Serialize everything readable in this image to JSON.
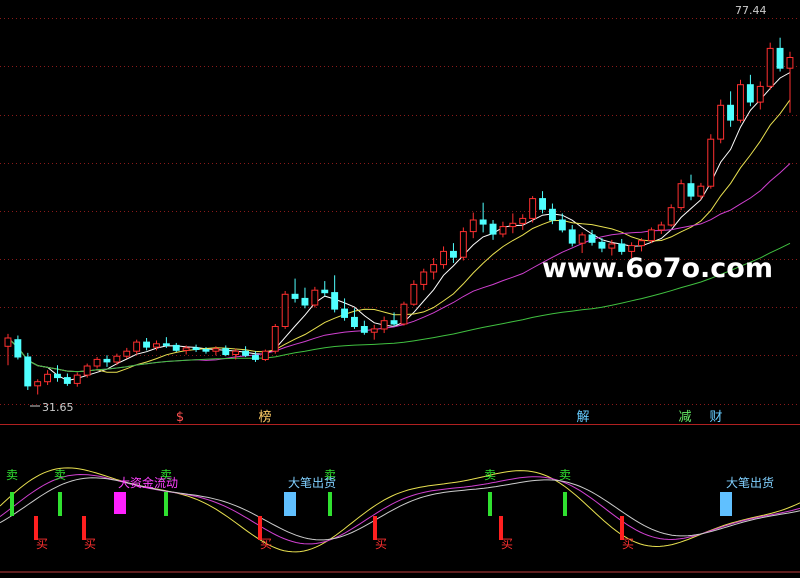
{
  "chart_data": {
    "type": "candlestick",
    "y_top_label": "77.44",
    "y_low_label": "31.65",
    "watermark": "www.6o7o.com",
    "markers": [
      {
        "text": "$",
        "color": "#ff5050"
      },
      {
        "text": "榜",
        "color": "#ffcc66"
      },
      {
        "text": "解",
        "color": "#66ccff"
      },
      {
        "text": "减",
        "color": "#66ee66"
      },
      {
        "text": "财",
        "color": "#66ccff"
      }
    ],
    "lower_labels": {
      "sell": "卖",
      "buy": "买",
      "inflow": "大资金流动",
      "outflow": "大笔出货"
    },
    "candles": [
      [
        37.5,
        39,
        35.2,
        38.5
      ],
      [
        38.3,
        38.8,
        35.9,
        36.2
      ],
      [
        36.2,
        36.7,
        32.2,
        32.7
      ],
      [
        32.7,
        33.5,
        31.65,
        33.2
      ],
      [
        33.2,
        34.6,
        32.8,
        34.1
      ],
      [
        34.1,
        35.2,
        33.2,
        33.7
      ],
      [
        33.7,
        34.2,
        32.7,
        33.0
      ],
      [
        33.0,
        34.3,
        32.6,
        34.0
      ],
      [
        34.0,
        35.4,
        33.7,
        35.1
      ],
      [
        35.1,
        36.2,
        34.8,
        35.9
      ],
      [
        35.9,
        36.4,
        35.0,
        35.6
      ],
      [
        35.6,
        36.6,
        35.2,
        36.3
      ],
      [
        36.3,
        37.3,
        36.0,
        36.9
      ],
      [
        36.9,
        38.3,
        36.5,
        38.0
      ],
      [
        38.0,
        38.5,
        37.0,
        37.4
      ],
      [
        37.4,
        38.2,
        37.0,
        37.8
      ],
      [
        37.8,
        38.6,
        37.3,
        37.6
      ],
      [
        37.6,
        37.9,
        36.8,
        37.0
      ],
      [
        37.0,
        37.6,
        36.5,
        37.3
      ],
      [
        37.3,
        37.7,
        36.8,
        37.1
      ],
      [
        37.1,
        37.4,
        36.6,
        36.9
      ],
      [
        36.9,
        37.5,
        36.4,
        37.2
      ],
      [
        37.2,
        37.6,
        36.3,
        36.5
      ],
      [
        36.5,
        37.2,
        35.9,
        36.9
      ],
      [
        36.9,
        37.5,
        36.2,
        36.4
      ],
      [
        36.4,
        36.9,
        35.6,
        35.9
      ],
      [
        35.9,
        37.1,
        35.7,
        36.9
      ],
      [
        36.9,
        40.2,
        36.6,
        39.9
      ],
      [
        39.9,
        44.2,
        39.6,
        43.8
      ],
      [
        43.8,
        45.7,
        42.8,
        43.3
      ],
      [
        43.3,
        44.6,
        42.1,
        42.5
      ],
      [
        42.5,
        44.7,
        42.2,
        44.3
      ],
      [
        44.3,
        45.4,
        43.6,
        44.0
      ],
      [
        44.0,
        46.1,
        41.6,
        42.0
      ],
      [
        42.0,
        43.3,
        40.6,
        41.0
      ],
      [
        41.0,
        42.1,
        39.6,
        39.9
      ],
      [
        39.9,
        40.6,
        38.9,
        39.2
      ],
      [
        39.2,
        40.1,
        38.3,
        39.6
      ],
      [
        39.6,
        41.1,
        39.1,
        40.6
      ],
      [
        40.6,
        41.6,
        39.9,
        40.2
      ],
      [
        40.2,
        42.9,
        40.0,
        42.6
      ],
      [
        42.6,
        45.5,
        42.4,
        45.0
      ],
      [
        45.0,
        46.9,
        44.3,
        46.5
      ],
      [
        46.5,
        48.2,
        45.6,
        47.4
      ],
      [
        47.4,
        49.6,
        46.9,
        49.0
      ],
      [
        49.0,
        50.0,
        47.6,
        48.3
      ],
      [
        48.3,
        51.9,
        47.9,
        51.4
      ],
      [
        51.4,
        53.7,
        50.6,
        52.8
      ],
      [
        52.8,
        54.9,
        51.3,
        52.3
      ],
      [
        52.3,
        52.8,
        50.4,
        51.1
      ],
      [
        51.1,
        52.6,
        50.7,
        52.0
      ],
      [
        52.0,
        53.6,
        51.2,
        52.4
      ],
      [
        52.4,
        53.5,
        51.6,
        53.0
      ],
      [
        53.0,
        55.7,
        52.5,
        55.4
      ],
      [
        55.4,
        56.3,
        53.6,
        54.1
      ],
      [
        54.1,
        54.8,
        52.3,
        52.8
      ],
      [
        52.8,
        53.6,
        51.3,
        51.6
      ],
      [
        51.6,
        52.2,
        49.6,
        50.0
      ],
      [
        50.0,
        51.3,
        48.8,
        51.0
      ],
      [
        51.0,
        51.6,
        49.7,
        50.1
      ],
      [
        50.1,
        50.6,
        48.9,
        49.4
      ],
      [
        49.4,
        50.4,
        48.5,
        49.9
      ],
      [
        49.9,
        50.5,
        48.6,
        49.0
      ],
      [
        49.0,
        50.1,
        48.2,
        49.7
      ],
      [
        49.7,
        50.6,
        49.0,
        50.3
      ],
      [
        50.3,
        51.9,
        50.0,
        51.6
      ],
      [
        51.6,
        52.6,
        51.1,
        52.2
      ],
      [
        52.2,
        54.7,
        52.0,
        54.3
      ],
      [
        54.3,
        57.7,
        54.0,
        57.2
      ],
      [
        57.2,
        58.3,
        55.2,
        55.7
      ],
      [
        55.7,
        57.3,
        55.3,
        56.9
      ],
      [
        56.9,
        63.2,
        56.6,
        62.6
      ],
      [
        62.6,
        67.4,
        62.1,
        66.7
      ],
      [
        66.7,
        68.4,
        64.1,
        64.9
      ],
      [
        64.9,
        69.8,
        64.6,
        69.2
      ],
      [
        69.2,
        70.4,
        66.6,
        67.1
      ],
      [
        67.1,
        69.6,
        66.2,
        69.0
      ],
      [
        69.0,
        74.3,
        68.6,
        73.6
      ],
      [
        73.6,
        74.9,
        70.8,
        71.2
      ],
      [
        71.2,
        73.2,
        65.8,
        72.5
      ]
    ]
  }
}
